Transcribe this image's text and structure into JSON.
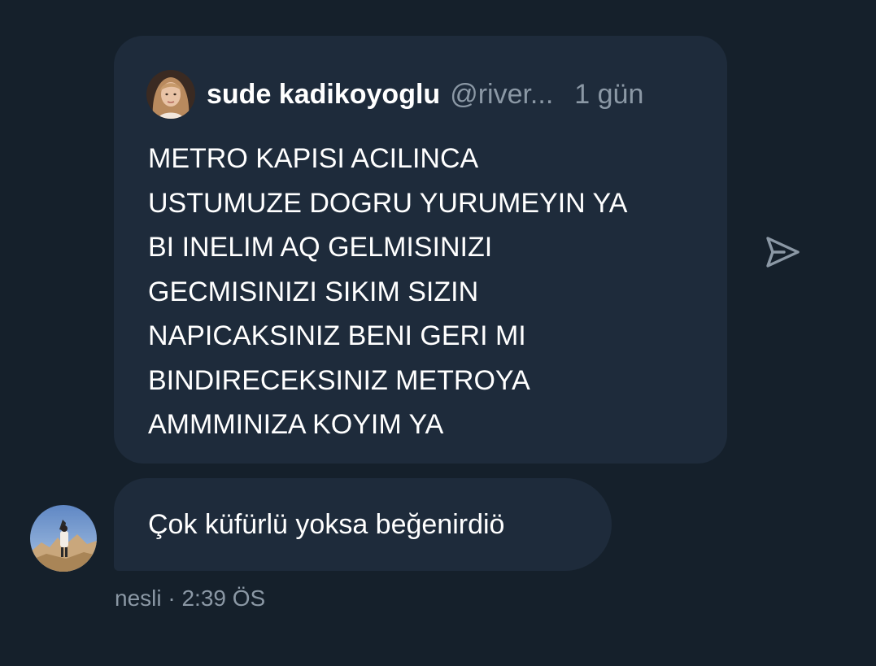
{
  "quoted_tweet": {
    "author_name": "sude kadikoyoglu",
    "author_handle": "@river...",
    "time_ago": "1 gün",
    "text_lines": [
      "METRO KAPISI ACILINCA",
      "USTUMUZE DOGRU YURUMEYIN YA",
      "BI INELIM AQ GELMISINIZI",
      "GECMISINIZI SIKIM SIZIN",
      "NAPICAKSINIZ BENI GERI MI",
      "BINDIRECEKSINIZ METROYA",
      "AMMMINIZA KOYIM YA"
    ]
  },
  "share_icon": "send-icon",
  "reply": {
    "text": "Çok küfürlü yoksa beğenirdiö",
    "meta": "nesli · 2:39 ÖS"
  },
  "colors": {
    "background": "#15202b",
    "bubble": "#1e2b3b",
    "text_primary": "#ffffff",
    "text_secondary": "#8b98a5"
  }
}
